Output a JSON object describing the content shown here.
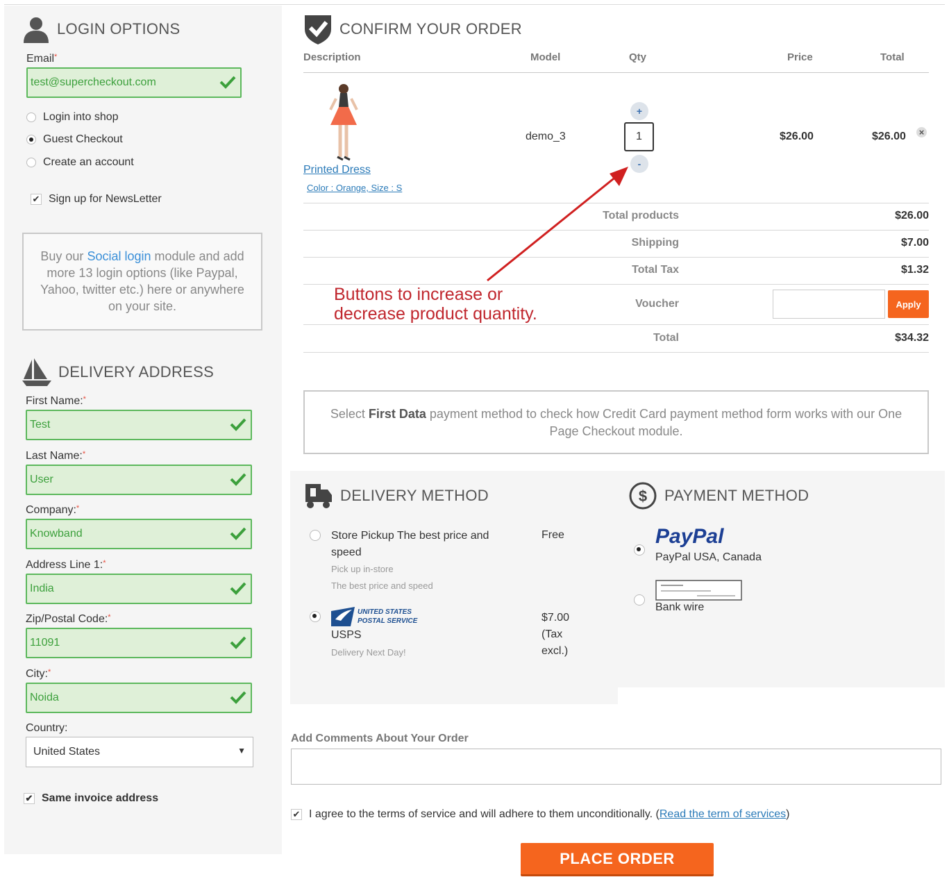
{
  "login": {
    "title": "LOGIN OPTIONS",
    "email_label": "Email",
    "email_value": "test@supercheckout.com",
    "options": [
      "Login into shop",
      "Guest Checkout",
      "Create an account"
    ],
    "selected_option": "Guest Checkout",
    "newsletter_label": "Sign up for NewsLetter",
    "promo_pre": "Buy our ",
    "promo_link": "Social login",
    "promo_post": " module and add more 13 login options (like Paypal, Yahoo, twitter etc.) here or anywhere on your site."
  },
  "delivery_address": {
    "title": "DELIVERY ADDRESS",
    "fields": [
      {
        "label": "First Name:",
        "value": "Test"
      },
      {
        "label": "Last Name:",
        "value": "User"
      },
      {
        "label": "Company:",
        "value": "Knowband"
      },
      {
        "label": "Address Line 1:",
        "value": "India"
      },
      {
        "label": "Zip/Postal Code:",
        "value": "11091"
      },
      {
        "label": "City:",
        "value": "Noida"
      }
    ],
    "country_label": "Country:",
    "country_value": "United States",
    "same_invoice_label": "Same invoice address"
  },
  "order": {
    "title": "CONFIRM YOUR ORDER",
    "headers": {
      "description": "Description",
      "model": "Model",
      "qty": "Qty",
      "price": "Price",
      "total": "Total"
    },
    "item": {
      "name": "Printed Dress",
      "attributes": "Color : Orange, Size : S",
      "model": "demo_3",
      "qty": "1",
      "price": "$26.00",
      "total": "$26.00",
      "plus": "+",
      "minus": "-",
      "remove": "×"
    },
    "summary": {
      "total_products_label": "Total products",
      "total_products": "$26.00",
      "shipping_label": "Shipping",
      "shipping": "$7.00",
      "tax_label": "Total Tax",
      "tax": "$1.32",
      "voucher_label": "Voucher",
      "apply_label": "Apply",
      "total_label": "Total",
      "total": "$34.32"
    },
    "annotation": "Buttons to increase or decrease product quantity."
  },
  "payment_note": {
    "pre": "Select ",
    "bold": "First Data",
    "post": " payment method to check how Credit Card payment method form works with our One Page Checkout module."
  },
  "delivery_method": {
    "title": "DELIVERY METHOD",
    "options": [
      {
        "name": "Store Pickup The best price and speed",
        "desc1": "Pick up in-store",
        "desc2": "The best price and speed",
        "price": "Free"
      },
      {
        "logo_line1": "UNITED STATES",
        "logo_line2": "POSTAL SERVICE",
        "name": "USPS",
        "desc1": "Delivery Next Day!",
        "price": "$7.00 (Tax excl.)"
      }
    ]
  },
  "payment_method": {
    "title": "PAYMENT METHOD",
    "paypal_logo": "PayPal",
    "paypal_label": "PayPal USA, Canada",
    "bank_label": "Bank wire"
  },
  "comments": {
    "label": "Add Comments About Your Order"
  },
  "terms": {
    "text": "I agree to the terms of service and will adhere to them unconditionally. (",
    "link": "Read the term of services",
    "close": ")"
  },
  "place_order": "PLACE ORDER",
  "colors": {
    "accent": "#f5651e",
    "valid_green": "#5cb85c",
    "link": "#2a7ab8",
    "annotation_red": "#c0262d"
  }
}
